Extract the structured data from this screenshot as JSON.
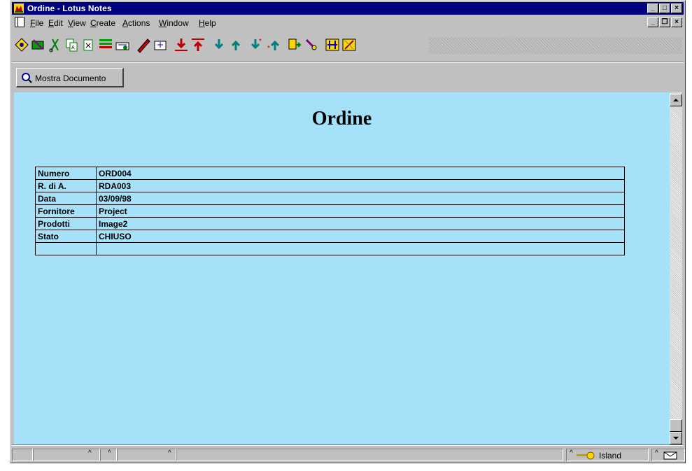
{
  "window": {
    "title": "Ordine - Lotus Notes",
    "title_bar_color": "#000080",
    "buttons": [
      "minimize-icon",
      "maximize-icon",
      "close-icon"
    ]
  },
  "menubar": {
    "items": [
      "File",
      "Edit",
      "View",
      "Create",
      "Actions",
      "Window",
      "Help"
    ]
  },
  "toolbar": {
    "icons": [
      "navigate-icon",
      "mail-icon",
      "cut-icon",
      "copy-icon",
      "paste-icon",
      "edit-icon",
      "link-icon",
      "pen-icon",
      "folder-icon",
      "arrow-down-icon",
      "arrow-up-icon",
      "next-icon",
      "prev-icon",
      "next-unread-icon",
      "prev-unread-icon",
      "doc-move-icon",
      "search-icon",
      "tools-icon",
      "wizard-icon"
    ]
  },
  "action_bar": {
    "button_label": "Mostra Documento"
  },
  "document": {
    "background": "#a5e1f8",
    "title": "Ordine",
    "rows": [
      {
        "key": "Numero",
        "value": "ORD004"
      },
      {
        "key": "R. di A.",
        "value": "RDA003"
      },
      {
        "key": "Data",
        "value": "03/09/98"
      },
      {
        "key": "Fornitore",
        "value": "Project"
      },
      {
        "key": "Prodotti",
        "value": "Image2"
      },
      {
        "key": "Stato",
        "value": "CHIUSO"
      },
      {
        "key": "",
        "value": ""
      }
    ]
  },
  "statusbar": {
    "location": "Island"
  }
}
